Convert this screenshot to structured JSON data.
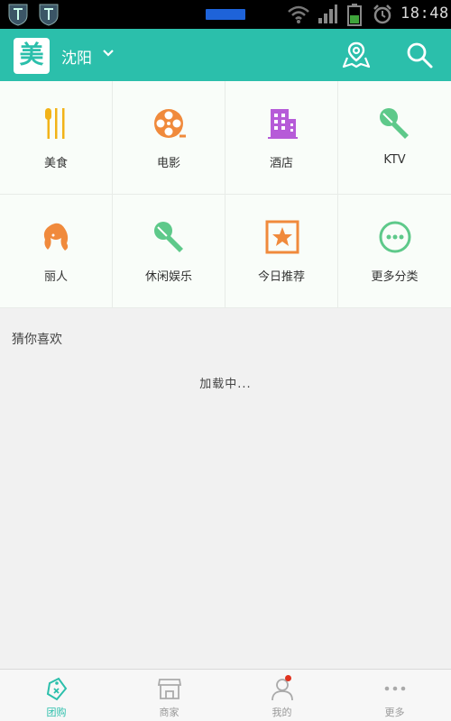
{
  "status_bar": {
    "time": "18:48",
    "icons": [
      "notification-icon",
      "notification-icon",
      "wifi-icon",
      "signal-icon",
      "battery-icon",
      "alarm-icon"
    ]
  },
  "header": {
    "logo_text": "美",
    "city": "沈阳",
    "icons": [
      "chevron-down-icon",
      "map-pin-icon",
      "search-icon"
    ],
    "accent_color": "#2bbfab"
  },
  "categories": [
    {
      "label": "美食",
      "icon": "fork-knife-icon",
      "color": "#f2b318"
    },
    {
      "label": "电影",
      "icon": "film-reel-icon",
      "color": "#f08a3c"
    },
    {
      "label": "酒店",
      "icon": "hotel-building-icon",
      "color": "#b65bd8"
    },
    {
      "label": "KTV",
      "icon": "microphone-icon",
      "color": "#5ec98a"
    },
    {
      "label": "丽人",
      "icon": "woman-icon",
      "color": "#f08a3c"
    },
    {
      "label": "休闲娱乐",
      "icon": "microphone-icon",
      "color": "#5ec98a"
    },
    {
      "label": "今日推荐",
      "icon": "star-box-icon",
      "color": "#f08a3c"
    },
    {
      "label": "更多分类",
      "icon": "more-dots-icon",
      "color": "#5ec98a"
    }
  ],
  "recommend": {
    "title": "猜你喜欢",
    "loading_text": "加载中..."
  },
  "bottom_nav": [
    {
      "label": "团购",
      "icon": "tag-icon",
      "active": true
    },
    {
      "label": "商家",
      "icon": "store-icon",
      "active": false
    },
    {
      "label": "我的",
      "icon": "user-icon",
      "active": false,
      "badge": true
    },
    {
      "label": "更多",
      "icon": "more-dots-icon",
      "active": false
    }
  ]
}
